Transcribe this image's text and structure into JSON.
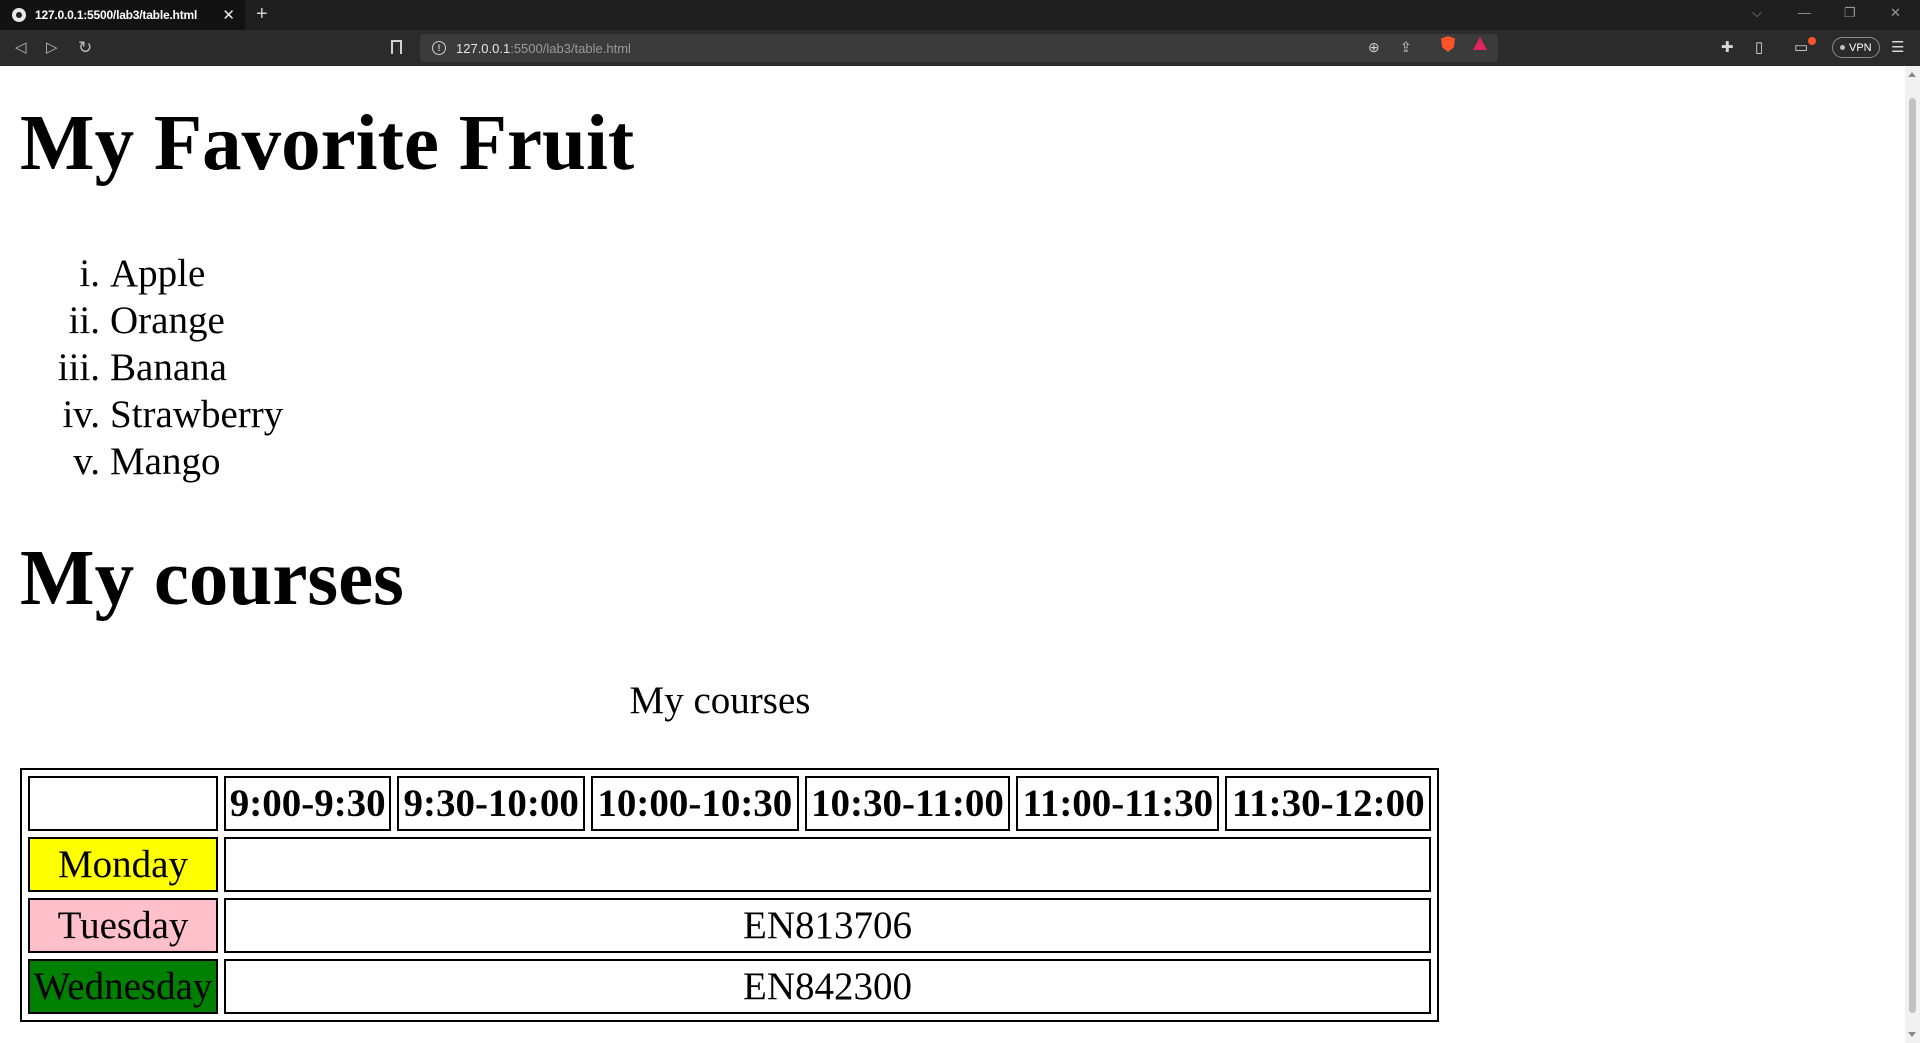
{
  "browser": {
    "tab_title": "127.0.0.1:5500/lab3/table.html",
    "url_host": "127.0.0.1",
    "url_path": ":5500/lab3/table.html",
    "vpn_label": "VPN"
  },
  "page": {
    "heading_fruit": "My Favorite Fruit",
    "fruits": [
      {
        "num": "i.",
        "name": "Apple"
      },
      {
        "num": "ii.",
        "name": "Orange"
      },
      {
        "num": "iii.",
        "name": "Banana"
      },
      {
        "num": "iv.",
        "name": "Strawberry"
      },
      {
        "num": "v.",
        "name": "Mango"
      }
    ],
    "heading_courses": "My courses",
    "table_caption": "My courses",
    "time_slots": [
      "9:00-9:30",
      "9:30-10:00",
      "10:00-10:30",
      "10:30-11:00",
      "11:00-11:30",
      "11:30-12:00"
    ],
    "rows": [
      {
        "day": "Monday",
        "day_color": "#ffff00",
        "course": ""
      },
      {
        "day": "Tuesday",
        "day_color": "#ffc0cb",
        "course": "EN813706"
      },
      {
        "day": "Wednesday",
        "day_color": "#008000",
        "course": "EN842300"
      }
    ]
  }
}
